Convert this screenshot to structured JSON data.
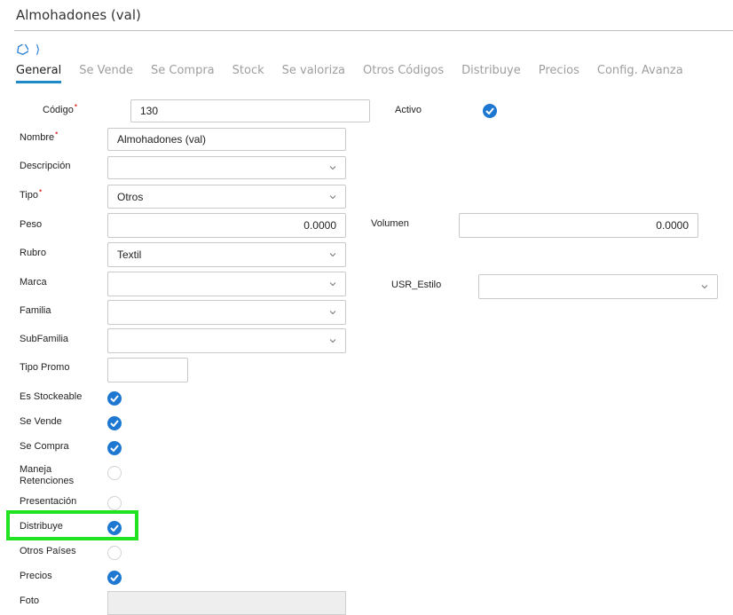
{
  "header": {
    "title": "Almohadones (val)"
  },
  "breadcrumb": {
    "sep": "⟩"
  },
  "tabs": [
    "General",
    "Se Vende",
    "Se Compra",
    "Stock",
    "Se valoriza",
    "Otros Códigos",
    "Distribuye",
    "Precios",
    "Config. Avanza"
  ],
  "form": {
    "codigo": {
      "label": "Código",
      "value": "130"
    },
    "activo": {
      "label": "Activo",
      "checked": true
    },
    "nombre": {
      "label": "Nombre",
      "value": "Almohadones (val)"
    },
    "descripcion": {
      "label": "Descripción",
      "value": ""
    },
    "tipo": {
      "label": "Tipo",
      "value": "Otros"
    },
    "peso": {
      "label": "Peso",
      "value": "0.0000"
    },
    "volumen": {
      "label": "Volumen",
      "value": "0.0000"
    },
    "rubro": {
      "label": "Rubro",
      "value": "Textil"
    },
    "marca": {
      "label": "Marca",
      "value": ""
    },
    "usr_estilo": {
      "label": "USR_Estilo",
      "value": ""
    },
    "familia": {
      "label": "Familia",
      "value": ""
    },
    "subfamilia": {
      "label": "SubFamilia",
      "value": ""
    },
    "tipo_promo": {
      "label": "Tipo Promo",
      "value": ""
    },
    "es_stockeable": {
      "label": "Es Stockeable",
      "checked": true
    },
    "se_vende": {
      "label": "Se Vende",
      "checked": true
    },
    "se_compra": {
      "label": "Se Compra",
      "checked": true
    },
    "maneja_retenciones": {
      "label_1": "Maneja",
      "label_2": "Retenciones",
      "checked": false
    },
    "presentacion": {
      "label": "Presentación",
      "checked": false
    },
    "distribuye": {
      "label": "Distribuye",
      "checked": true
    },
    "otros_paises": {
      "label": "Otros Países",
      "checked": false
    },
    "precios": {
      "label": "Precios",
      "checked": true
    },
    "foto": {
      "label": "Foto"
    }
  },
  "colors": {
    "accent": "#1e78d2",
    "highlight": "#21e321",
    "required": "#e53935"
  }
}
